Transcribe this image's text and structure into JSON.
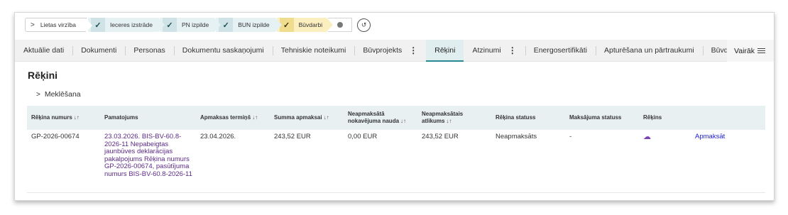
{
  "progress": {
    "first_label": "Lietas virzība",
    "steps": [
      "Ieceres izstrāde",
      "PN izpilde",
      "BUN izpilde"
    ],
    "current": "Būvdarbi"
  },
  "tabs": [
    {
      "label": "Aktuālie dati",
      "active": false,
      "menu": false
    },
    {
      "label": "Dokumenti",
      "active": false,
      "menu": false
    },
    {
      "label": "Personas",
      "active": false,
      "menu": false
    },
    {
      "label": "Dokumentu saskaņojumi",
      "active": false,
      "menu": false
    },
    {
      "label": "Tehniskie noteikumi",
      "active": false,
      "menu": false
    },
    {
      "label": "Būvprojekts",
      "active": false,
      "menu": true
    },
    {
      "label": "Rēķini",
      "active": true,
      "menu": false
    },
    {
      "label": "Atzinumi",
      "active": false,
      "menu": true
    },
    {
      "label": "Energosertifikāti",
      "active": false,
      "menu": false
    },
    {
      "label": "Apturēšana un pārtraukumi",
      "active": false,
      "menu": false
    },
    {
      "label": "Būvdarbu gaita",
      "active": false,
      "menu": false
    }
  ],
  "more_label": "Vairāk",
  "page_title": "Rēķini",
  "search_label": "Meklēšana",
  "table": {
    "headers": [
      {
        "text": "Rēķina numurs",
        "sort": true
      },
      {
        "text": "Pamatojums",
        "sort": false
      },
      {
        "text": "Apmaksas termiņš",
        "sort": true
      },
      {
        "text": "Summa apmaksai",
        "sort": true
      },
      {
        "text": "Neapmaksātā nokavējuma nauda",
        "sort": true
      },
      {
        "text": "Neapmaksātais atlikums",
        "sort": true
      },
      {
        "text": "Rēķina statuss",
        "sort": false
      },
      {
        "text": "Maksājuma statuss",
        "sort": false
      },
      {
        "text": "Rēķins",
        "sort": false
      },
      {
        "text": "",
        "sort": false
      }
    ],
    "sort_glyph": "↓↑",
    "rows": [
      {
        "number": "GP-2026-00674",
        "basis": "23.03.2026. BIS-BV-60.8-2026-11 Nepabeigtas jaunbūves deklarācijas pakalpojums Rēķina numurs GP-2026-00674, pasūtījuma numurs BIS-BV-60.8-2026-11",
        "due": "23.04.2026.",
        "amount": "243,52 EUR",
        "penalty": "0,00 EUR",
        "remaining": "243,52 EUR",
        "status": "Neapmaksāts",
        "payment_status": "-",
        "action": "Apmaksāt"
      }
    ]
  }
}
